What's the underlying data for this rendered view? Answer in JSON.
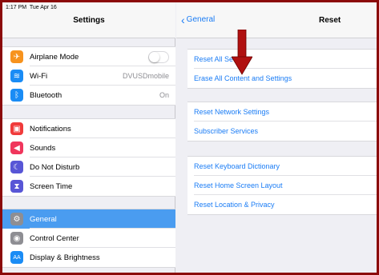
{
  "status_bar": {
    "time": "1:17 PM",
    "date": "Tue Apr 16"
  },
  "left": {
    "title": "Settings",
    "group1": [
      {
        "label": "Airplane Mode",
        "icon": "airplane-icon",
        "color": "#f7931e",
        "glyph": "✈",
        "toggle": true
      },
      {
        "label": "Wi-Fi",
        "icon": "wifi-icon",
        "color": "#1a8cf5",
        "glyph": "≋",
        "value": "DVUSDmobile"
      },
      {
        "label": "Bluetooth",
        "icon": "bluetooth-icon",
        "color": "#1a8cf5",
        "glyph": "ᛒ",
        "value": "On"
      }
    ],
    "group2": [
      {
        "label": "Notifications",
        "icon": "notifications-icon",
        "color": "#f03b3b",
        "glyph": "▣"
      },
      {
        "label": "Sounds",
        "icon": "sounds-icon",
        "color": "#f0365c",
        "glyph": "◀"
      },
      {
        "label": "Do Not Disturb",
        "icon": "moon-icon",
        "color": "#5856d6",
        "glyph": "☾"
      },
      {
        "label": "Screen Time",
        "icon": "hourglass-icon",
        "color": "#5856d6",
        "glyph": "⧗"
      }
    ],
    "group3": [
      {
        "label": "General",
        "icon": "gear-icon",
        "color": "#8e8e93",
        "glyph": "⚙",
        "selected": true
      },
      {
        "label": "Control Center",
        "icon": "control-center-icon",
        "color": "#8e8e93",
        "glyph": "◉"
      },
      {
        "label": "Display & Brightness",
        "icon": "display-icon",
        "color": "#1a8cf5",
        "glyph": "AA"
      }
    ]
  },
  "right": {
    "back_label": "General",
    "title": "Reset",
    "group1": [
      "Reset All Settings",
      "Erase All Content and Settings"
    ],
    "group2": [
      "Reset Network Settings",
      "Subscriber Services"
    ],
    "group3": [
      "Reset Keyboard Dictionary",
      "Reset Home Screen Layout",
      "Reset Location & Privacy"
    ]
  },
  "colors": {
    "accent": "#1a7cf5",
    "selected": "#4a9cf0",
    "annotation_arrow": "#b01010"
  }
}
